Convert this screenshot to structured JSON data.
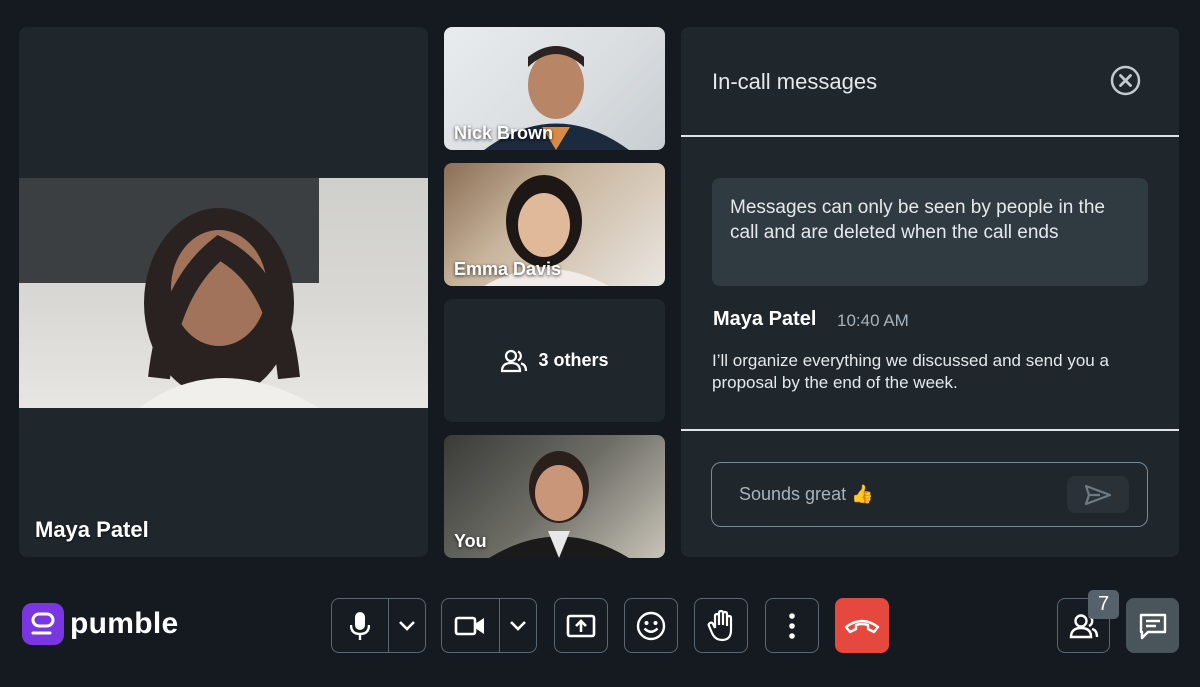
{
  "participants": {
    "main": {
      "name": "Maya Patel"
    },
    "tiles": [
      {
        "name": "Nick Brown"
      },
      {
        "name": "Emma Davis"
      },
      {
        "others_label": "3 others"
      },
      {
        "name": "You"
      }
    ]
  },
  "chat": {
    "title": "In-call messages",
    "notice": "Messages can only be seen by people in the call and are deleted when the call ends",
    "messages": [
      {
        "author": "Maya Patel",
        "time": "10:40 AM",
        "text": "I’ll organize everything we discussed and send you a proposal by the end of the week."
      }
    ],
    "input_value": "Sounds great 👍"
  },
  "toolbar": {
    "logo_text": "pumble",
    "participants_count": "7",
    "accent_color": "#7a36e0",
    "end_call_color": "#e5483c"
  },
  "icons": [
    "microphone-icon",
    "chevron-down-icon",
    "video-camera-icon",
    "screen-share-icon",
    "emoji-icon",
    "raise-hand-icon",
    "more-vertical-icon",
    "end-call-icon",
    "participants-icon",
    "chat-icon",
    "close-icon",
    "send-icon",
    "people-icon"
  ]
}
